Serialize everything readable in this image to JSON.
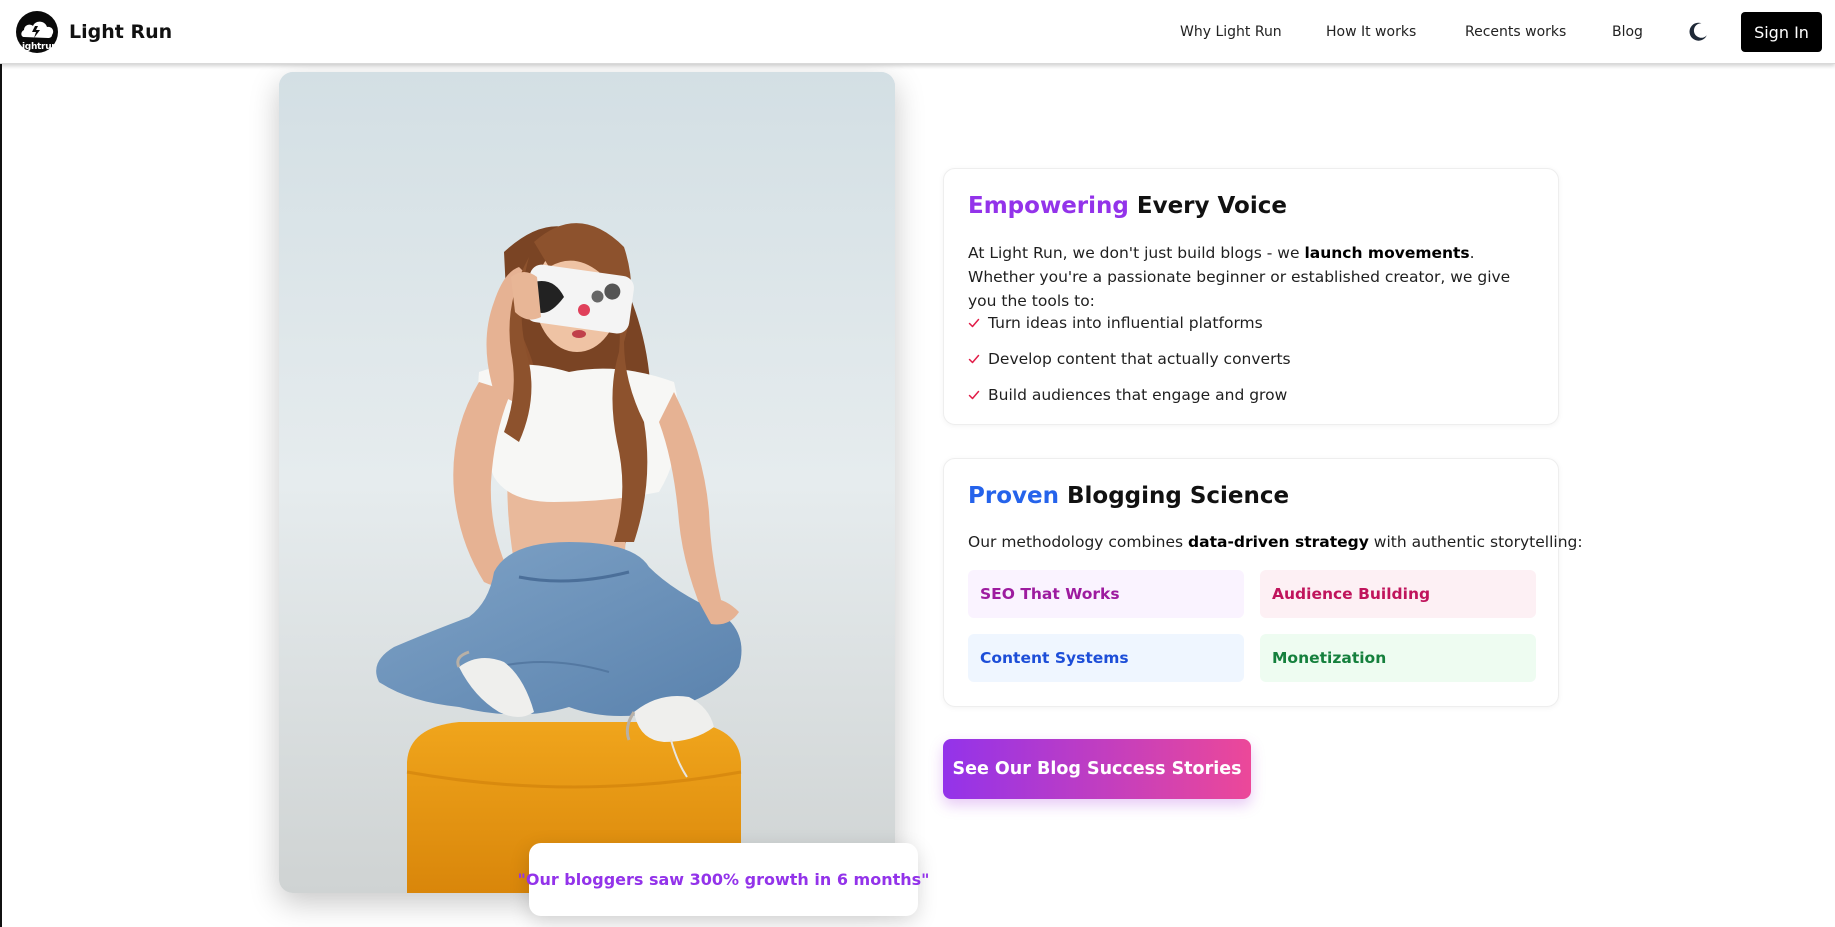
{
  "header": {
    "logo_text": "Lightrun",
    "brand_name": "Light Run",
    "nav": [
      {
        "label": "Why Light Run"
      },
      {
        "label": "How It works"
      },
      {
        "label": "Recents works"
      },
      {
        "label": "Blog"
      }
    ],
    "theme_icon": "moon-icon",
    "signin_label": "Sign In"
  },
  "hero_image": {
    "description_icon": "photo-woman-with-phone"
  },
  "quote": "\"Our bloggers saw 300% growth in 6 months\"",
  "card_voice": {
    "title_accent": "Empowering",
    "title_rest": " Every Voice",
    "intro_before": "At Light Run, we don't just build blogs - we ",
    "intro_bold": "launch movements",
    "intro_after": ". Whether you're a passionate beginner or established creator, we give you the tools to:",
    "checklist": [
      "Turn ideas into influential platforms",
      "Develop content that actually converts",
      "Build audiences that engage and grow"
    ]
  },
  "card_science": {
    "title_accent": "Proven",
    "title_rest": " Blogging Science",
    "method_before": "Our methodology combines ",
    "method_bold": "data-driven strategy",
    "method_after": " with authentic storytelling:",
    "pills": [
      "SEO That Works",
      "Audience Building",
      "Content Systems",
      "Monetization"
    ]
  },
  "cta_label": "See Our Blog Success Stories",
  "colors": {
    "accent_purple": "#9333ea",
    "accent_blue": "#2563eb",
    "cta_gradient_start": "#9333ea",
    "cta_gradient_end": "#ec4899",
    "check_red": "#e11d48"
  }
}
